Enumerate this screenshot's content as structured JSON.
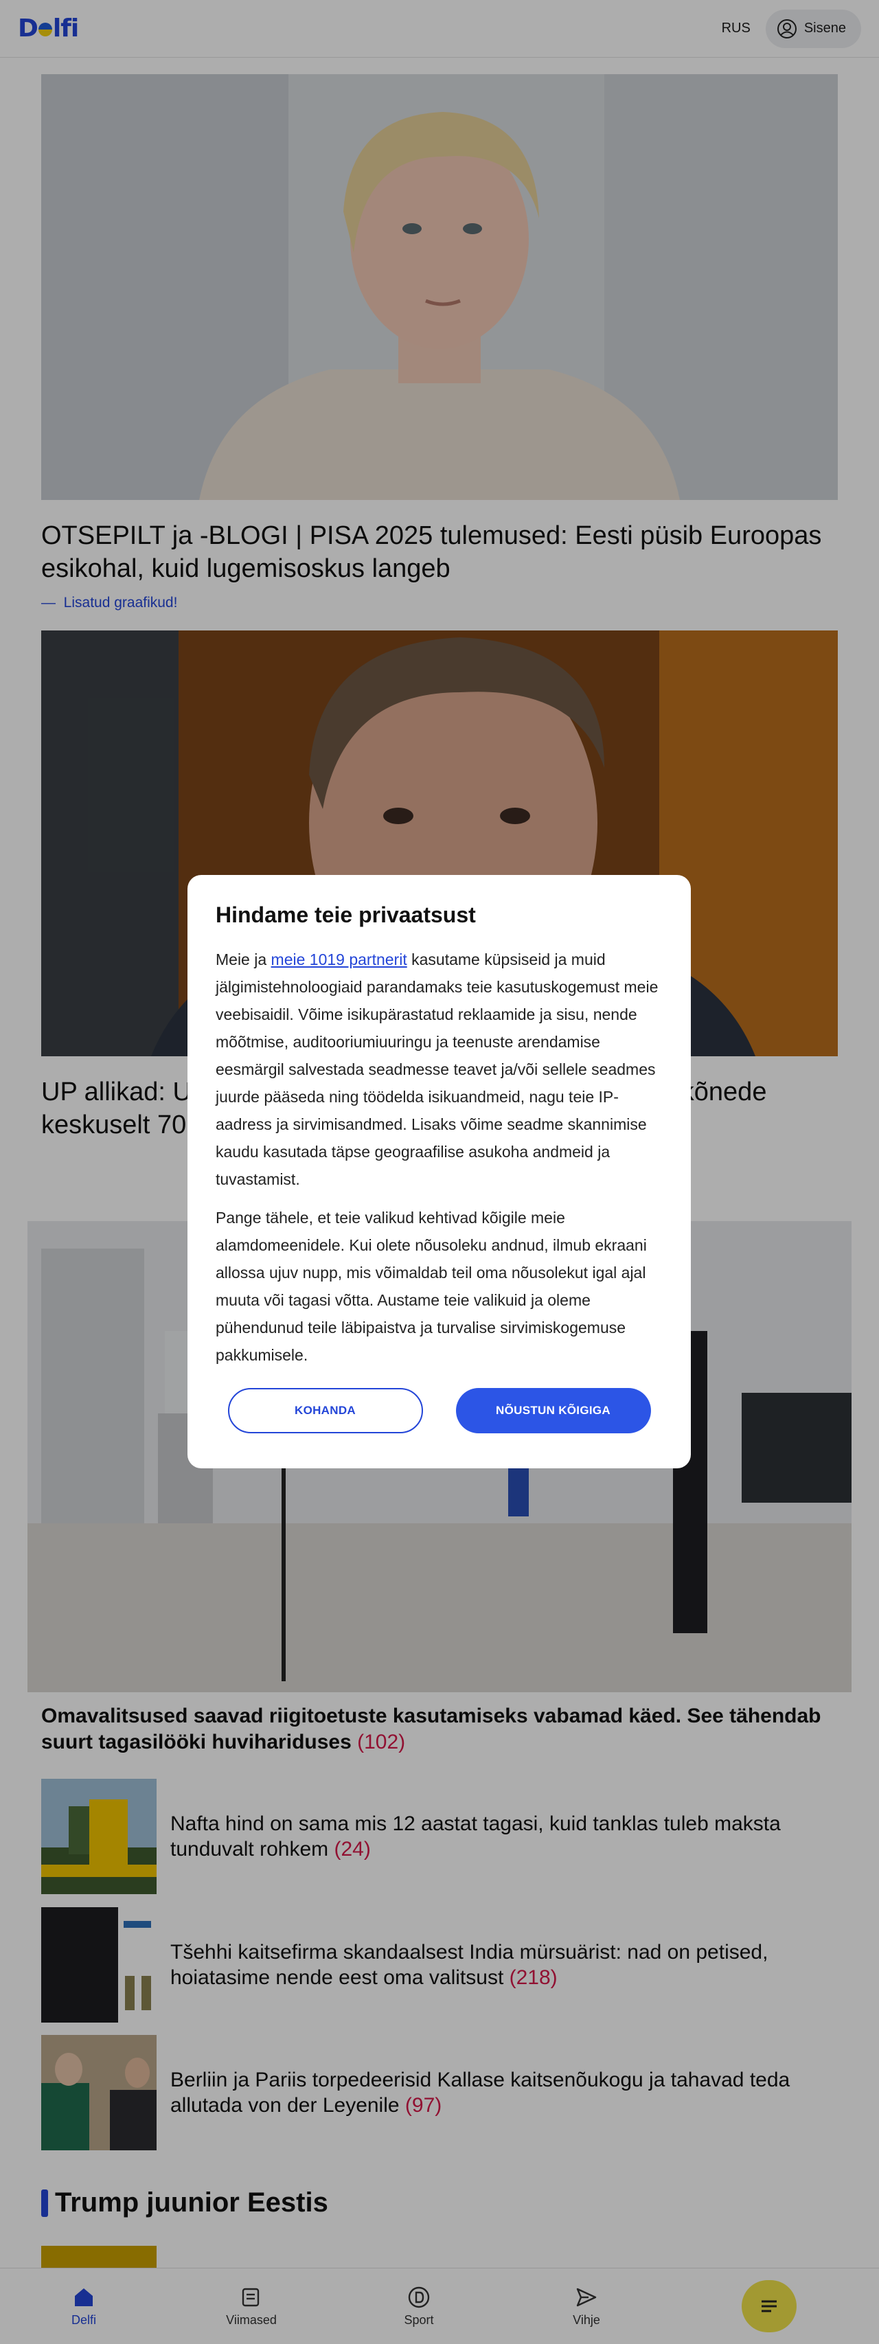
{
  "header": {
    "logo_text": "Delfi",
    "lang": "RUS",
    "signin_label": "Sisene"
  },
  "feed": {
    "lead1": {
      "headline": "OTSEPILT ja -BLOGI | PISA 2025 tulemused: Eesti püsib Euroopas esikohal, kuid lugemisoskus langeb",
      "subline": "Lisatud graafikud!"
    },
    "lead2": {
      "headline_start": "UP allikad: U",
      "headline_end": "etukõnede",
      "headline_line2": "keskuselt 70"
    },
    "story3": {
      "title": "Omavalitsused saavad riigitoetuste kasutamiseks vabamad käed. See tähendab suurt tagasilööki huvihariduses",
      "count": "(102)"
    },
    "list": [
      {
        "title": "Nafta hind on sama mis 12 aastat tagasi, kuid tanklas tuleb maksta tunduvalt rohkem",
        "count": "(24)"
      },
      {
        "title": "Tšehhi kaitsefirma skandaalsest India mürsuärist: nad on petised, hoiatasime nende eest oma valitsust",
        "count": "(218)"
      },
      {
        "title": "Berliin ja Pariis torpedeerisid Kallase kaitsenõukogu ja tahavad teda allutada von der Leyenile",
        "count": "(97)"
      }
    ],
    "section_title": "Trump juunior Eestis"
  },
  "modal": {
    "title": "Hindame teie privaatsust",
    "p1_before": "Meie ja ",
    "p1_link": "meie 1019 partnerit",
    "p1_after": " kasutame küpsiseid ja muid jälgimistehnoloogiaid parandamaks teie kasutuskogemust meie veebisaidil. Võime isikupärastatud reklaamide ja sisu, nende mõõtmise, auditooriumiuuringu ja teenuste arendamise eesmärgil salvestada seadmesse teavet ja/või sellele seadmes juurde pääseda ning töödelda isikuandmeid, nagu teie IP-aadress ja sirvimisandmed. Lisaks võime seadme skannimise kaudu kasutada täpse geograafilise asukoha andmeid ja tuvastamist.",
    "p2": "Pange tähele, et teie valikud kehtivad kõigile meie alamdomeenidele. Kui olete nõusoleku andnud, ilmub ekraani allossa ujuv nupp, mis võimaldab teil oma nõusolekut igal ajal muuta või tagasi võtta. Austame teie valikuid ja oleme pühendunud teile läbipaistva ja turvalise sirvimiskogemuse pakkumisele.",
    "customize_label": "KOHANDA",
    "accept_label": "NÕUSTUN KÕIGIGA"
  },
  "bottom_nav": {
    "items": [
      {
        "label": "Delfi",
        "icon": "home-icon"
      },
      {
        "label": "Viimased",
        "icon": "news-icon"
      },
      {
        "label": "Sport",
        "icon": "sport-icon"
      },
      {
        "label": "Vihje",
        "icon": "send-icon"
      }
    ],
    "menu_icon": "menu-icon"
  },
  "colors": {
    "brand_blue": "#2446d8",
    "count_red": "#d61a4a",
    "menu_yellow": "#efe24a"
  }
}
